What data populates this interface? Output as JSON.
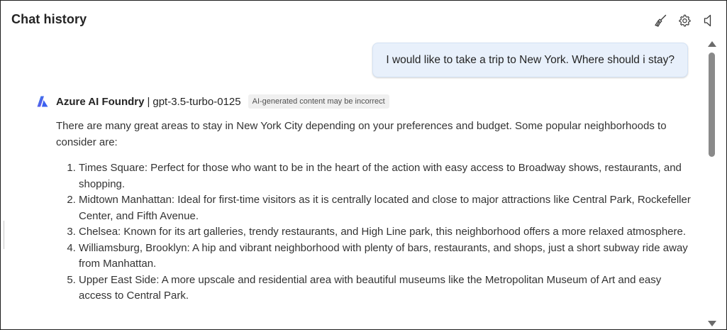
{
  "header": {
    "title": "Chat history",
    "actions": [
      {
        "icon": "broom-icon",
        "label": "Clear chat"
      },
      {
        "icon": "gear-icon",
        "label": "Settings"
      },
      {
        "icon": "speaker-icon",
        "label": "Speaker"
      }
    ]
  },
  "user_message": {
    "text": "I would like to take a trip to New York. Where should i stay?"
  },
  "assistant_message": {
    "source": "Azure AI Foundry",
    "separator": "|",
    "model": "gpt-3.5-turbo-0125",
    "badge": "AI-generated content may be incorrect",
    "intro": "There are many great areas to stay in New York City depending on your preferences and budget. Some popular neighborhoods to consider are:",
    "items": [
      "Times Square: Perfect for those who want to be in the heart of the action with easy access to Broadway shows, restaurants, and shopping.",
      "Midtown Manhattan: Ideal for first-time visitors as it is centrally located and close to major attractions like Central Park, Rockefeller Center, and Fifth Avenue.",
      "Chelsea: Known for its art galleries, trendy restaurants, and High Line park, this neighborhood offers a more relaxed atmosphere.",
      "Williamsburg, Brooklyn: A hip and vibrant neighborhood with plenty of bars, restaurants, and shops, just a short subway ride away from Manhattan.",
      "Upper East Side: A more upscale and residential area with beautiful museums like the Metropolitan Museum of Art and easy access to Central Park."
    ]
  },
  "colors": {
    "user_bubble_bg": "#e8f0fb",
    "logo_blue": "#2f6fe0",
    "logo_purple": "#7b3fe4"
  }
}
